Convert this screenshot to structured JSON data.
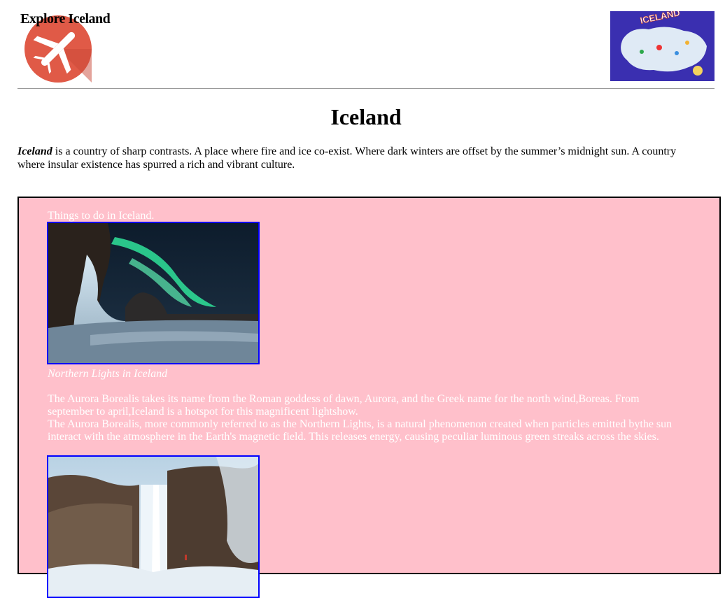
{
  "header": {
    "brand": "Explore Iceland",
    "logo_icon": "airplane-icon",
    "map_image": {
      "label": "ICELAND"
    }
  },
  "page": {
    "title": "Iceland"
  },
  "intro": {
    "name": "Iceland",
    "text": " is a country of sharp contrasts. A place where fire and ice co-exist. Where dark winters are offset by the summer’s midnight sun. A country where insular existence has spurred a rich and vibrant culture."
  },
  "activities": {
    "heading": "Things to do in Iceland.",
    "items": [
      {
        "caption": "Northern Lights in Iceland",
        "paragraphs": [
          "The Aurora Borealis takes its name from the Roman goddess of dawn, Aurora, and the Greek name for the north wind,Boreas. From september to april,Iceland is a hotspot for this magnificent lightshow.",
          "The Aurora Borealis, more commonly referred to as the Northern Lights, is a natural phenomenon created when particles emitted bythe sun interact with the atmosphere in the Earth's magnetic field. This releases energy, causing peculiar luminous green streaks across the skies."
        ]
      }
    ]
  },
  "colors": {
    "panel_background": "#ffc0cb",
    "photo_border": "#0000ff",
    "logo_circle": "#e05a47",
    "map_background": "#3a2fb0"
  }
}
